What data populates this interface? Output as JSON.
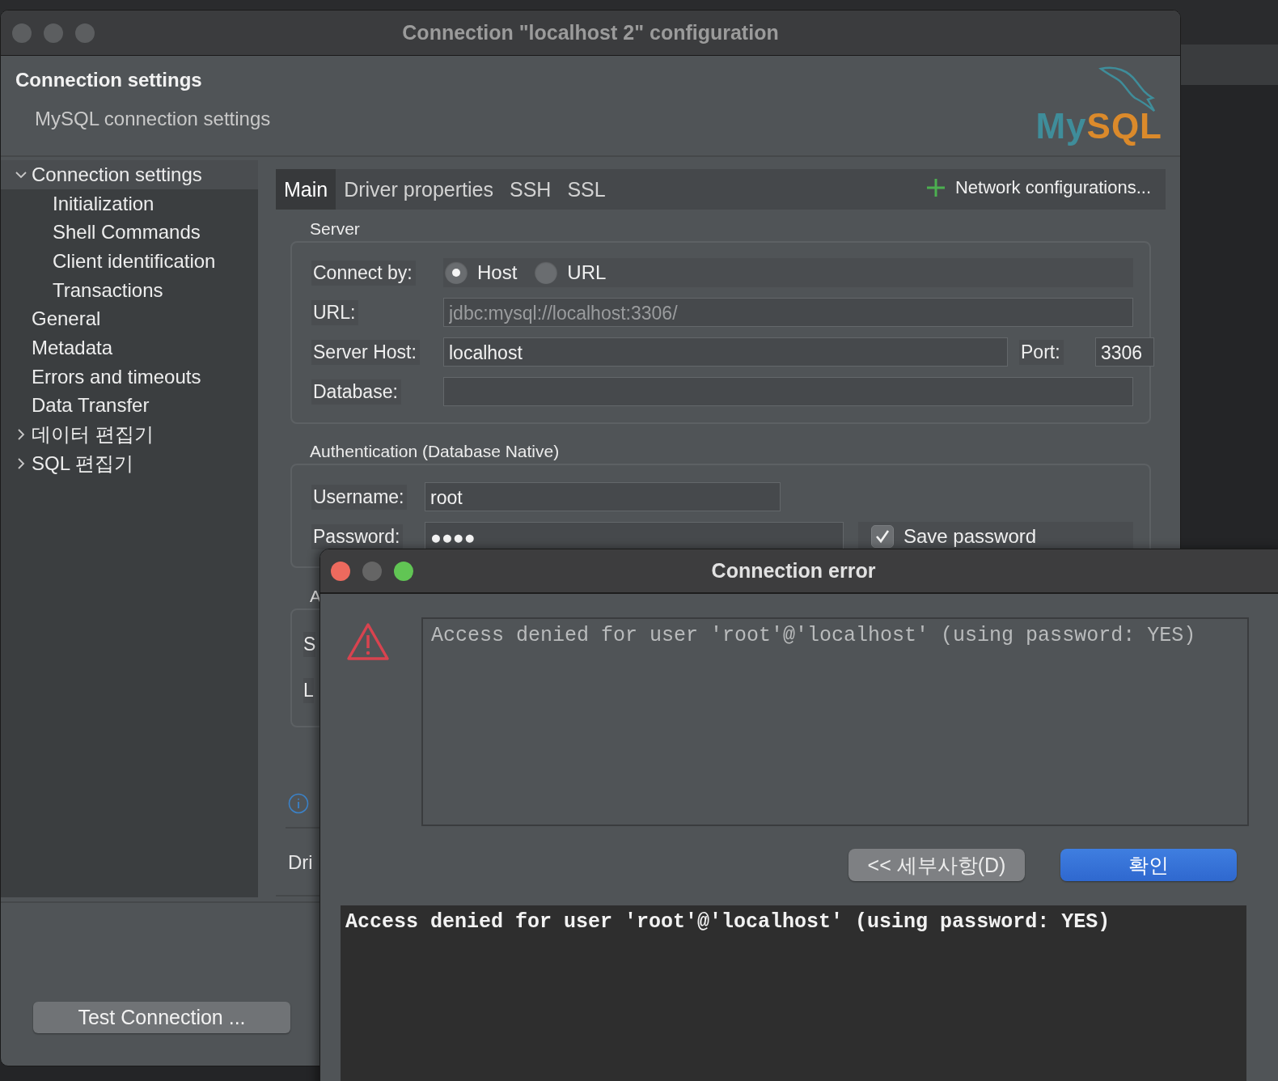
{
  "window": {
    "title": "Connection \"localhost 2\" configuration"
  },
  "header": {
    "title": "Connection settings",
    "subtitle": "MySQL connection settings",
    "logo": [
      "My",
      "SQL"
    ]
  },
  "tree": [
    {
      "label": "Connection settings",
      "selected": true,
      "expanded": true,
      "children": [
        {
          "label": "Initialization",
          "selected": false
        },
        {
          "label": "Shell Commands",
          "selected": false
        },
        {
          "label": "Client identification",
          "selected": false
        },
        {
          "label": "Transactions",
          "selected": false
        }
      ]
    },
    {
      "label": "General",
      "selected": false
    },
    {
      "label": "Metadata",
      "selected": false
    },
    {
      "label": "Errors and timeouts",
      "selected": false
    },
    {
      "label": "Data Transfer",
      "selected": false
    },
    {
      "label": "데이터 편집기",
      "selected": false,
      "expanded": false
    },
    {
      "label": "SQL 편집기",
      "selected": false,
      "expanded": false
    }
  ],
  "tabs": [
    {
      "label": "Main",
      "selected": true
    },
    {
      "label": "Driver properties",
      "selected": false
    },
    {
      "label": "SSH",
      "selected": false
    },
    {
      "label": "SSL",
      "selected": false
    }
  ],
  "network_button": "Network configurations...",
  "server": {
    "title": "Server",
    "connect_by": {
      "label": "Connect by:",
      "options": [
        {
          "label": "Host",
          "selected": true
        },
        {
          "label": "URL",
          "selected": false
        }
      ]
    },
    "url": {
      "label": "URL:",
      "value": "jdbc:mysql://localhost:3306/",
      "disabled": true
    },
    "host": {
      "label": "Server Host:",
      "value": "localhost"
    },
    "port": {
      "label": "Port:",
      "value": "3306"
    },
    "database": {
      "label": "Database:"
    }
  },
  "auth": {
    "title": "Authentication (Database Native)",
    "username": {
      "label": "Username:",
      "value": "root"
    },
    "password": {
      "label": "Password:",
      "value": "●●●●"
    },
    "save_password": {
      "label": "Save password",
      "checked": true
    }
  },
  "covered": {
    "group_title": "A",
    "row_labels": [
      "S",
      "L"
    ],
    "driver_label": "Dri"
  },
  "test_button": "Test Connection ...",
  "error_dialog": {
    "title": "Connection error",
    "message": "Access denied for user 'root'@'localhost' (using password: YES)",
    "buttons": [
      {
        "label": "<< 세부사항(D)",
        "kind": "secondary"
      },
      {
        "label": "확인",
        "kind": "primary"
      }
    ],
    "details": "Access denied for user 'root'@'localhost' (using password: YES)"
  }
}
